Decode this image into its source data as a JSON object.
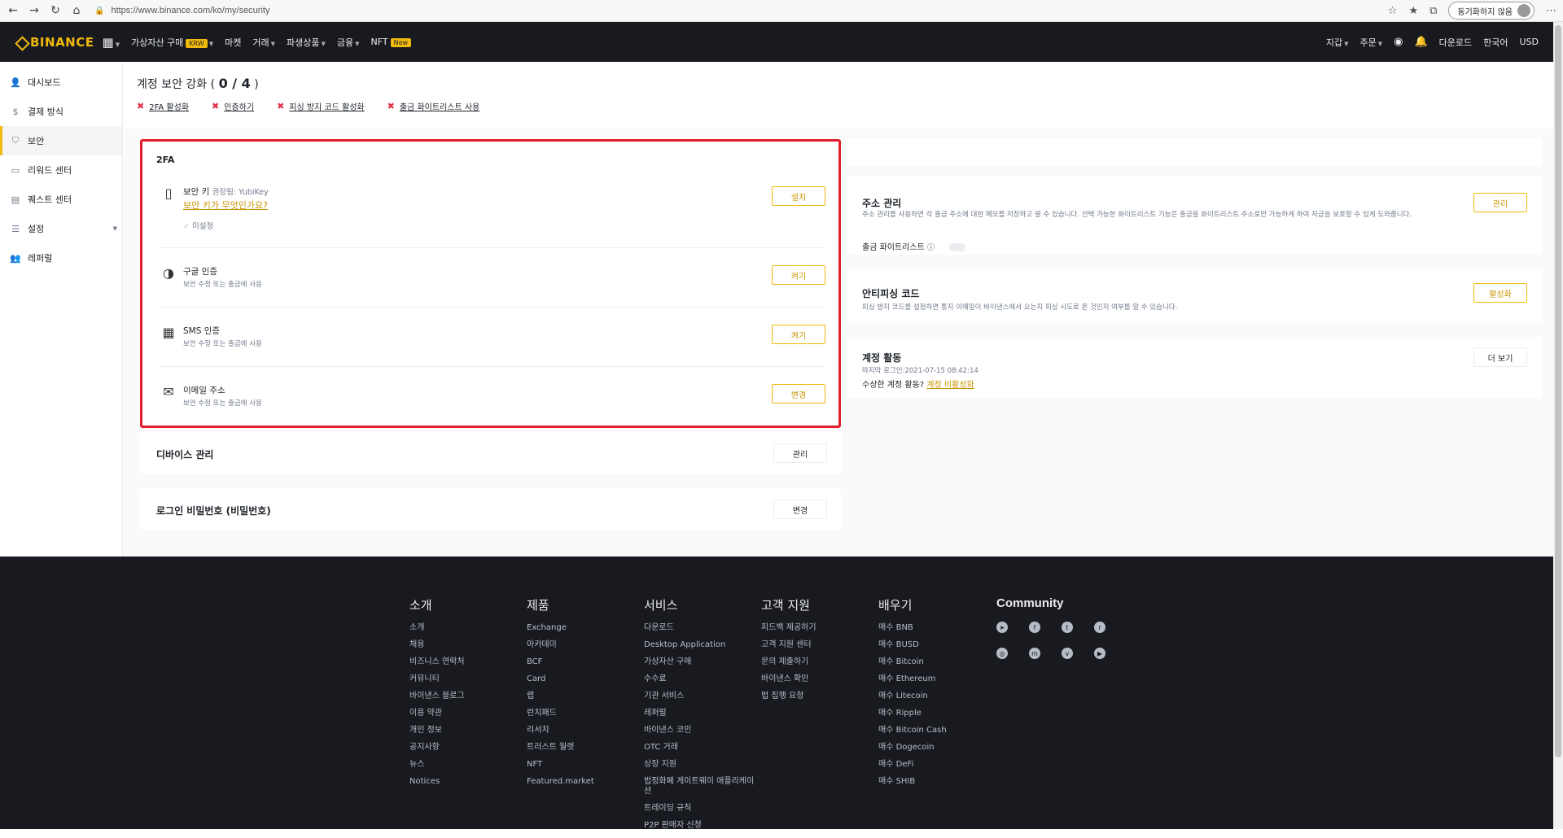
{
  "browser": {
    "url": "https://www.binance.com/ko/my/security",
    "sync_label": "동기화하지 않음"
  },
  "nav": {
    "logo": "BINANCE",
    "items": [
      "가상자산 구매",
      "마켓",
      "거래",
      "파생상품",
      "금융",
      "NFT"
    ],
    "krw_badge": "KRW",
    "new_badge": "New",
    "right": [
      "지갑",
      "주문",
      "다운로드",
      "한국어",
      "USD"
    ]
  },
  "sidebar": {
    "items": [
      {
        "label": "대시보드",
        "icon": "user-icon"
      },
      {
        "label": "결제 방식",
        "icon": "dollar-icon"
      },
      {
        "label": "보안",
        "icon": "shield-icon"
      },
      {
        "label": "리워드 센터",
        "icon": "ticket-icon"
      },
      {
        "label": "퀘스트 센터",
        "icon": "clipboard-icon"
      },
      {
        "label": "설정",
        "icon": "sliders-icon"
      },
      {
        "label": "레퍼럴",
        "icon": "user-plus-icon"
      }
    ]
  },
  "security": {
    "title": "계정 보안 강화",
    "progress": "0 / 4",
    "todos": [
      "2FA 활성화",
      "인증하기",
      "피싱 방지 코드 활성화",
      "출금 화이트리스트 사용"
    ]
  },
  "twofa": {
    "title": "2FA",
    "security_key": {
      "title": "보안 키",
      "recommended": "권장됨: YubiKey",
      "link": "보안 키가 무엇인가요?",
      "status": "미설정",
      "button": "설치"
    },
    "google": {
      "title": "구글 인증",
      "desc": "보안 수정 또는 출금에 사용",
      "button": "켜기"
    },
    "sms": {
      "title": "SMS 인증",
      "desc": "보안 수정 또는 출금에 사용",
      "button": "켜기"
    },
    "email": {
      "title": "이메일 주소",
      "desc": "보안 수정 또는 출금에 사용",
      "button": "변경"
    }
  },
  "device": {
    "title": "디바이스 관리",
    "button": "관리"
  },
  "password": {
    "title": "로그인 비밀번호 (비밀번호)",
    "button": "변경"
  },
  "address": {
    "title": "주소 관리",
    "desc": "주소 관리를 사용하면 각 출금 주소에 대한 메모를 저장하고 쓸 수 있습니다. 선택 가능한 화이트리스트 기능은 출금을 화이트리스트 주소로만 가능하게 하여 자금을 보호할 수 있게 도와줍니다.",
    "whitelist_label": "출금 화이트리스트",
    "button": "관리"
  },
  "antiphishing": {
    "title": "안티피싱 코드",
    "desc": "피싱 방지 코드를 설정하면 통지 이메일이 바이낸스에서 오는지 피싱 시도로 온 것인지 여부를 알 수 있습니다.",
    "button": "활성화"
  },
  "activity": {
    "title": "계정 활동",
    "last_login": "마지막 로그인:2021-07-15 08:42:14",
    "suspicious": "수상한 계정 활동?",
    "deactivate": "계정 비활성화",
    "button": "더 보기"
  },
  "footer": {
    "columns": [
      {
        "title": "소개",
        "links": [
          "소개",
          "채용",
          "비즈니스 연락처",
          "커뮤니티",
          "바이낸스 블로그",
          "이용 약관",
          "개인 정보",
          "공지사항",
          "뉴스",
          "Notices"
        ]
      },
      {
        "title": "제품",
        "links": [
          "Exchange",
          "아카데미",
          "BCF",
          "Card",
          "랩",
          "런치패드",
          "리서치",
          "트러스트 월렛",
          "NFT",
          "Featured.market"
        ]
      },
      {
        "title": "서비스",
        "links": [
          "다운로드",
          "Desktop Application",
          "가상자산 구매",
          "수수료",
          "기관 서비스",
          "레퍼럴",
          "바이낸스 코인",
          "OTC 거래",
          "상장 지원",
          "법정화폐 게이트웨이 애플리케이션",
          "트레이딩 규칙",
          "P2P 판매자 신청"
        ]
      },
      {
        "title": "고객 지원",
        "links": [
          "피드백 제공하기",
          "고객 지원 센터",
          "문의 제출하기",
          "바이낸스 확인",
          "법 집행 요청"
        ]
      },
      {
        "title": "배우기",
        "links": [
          "매수 BNB",
          "매수 BUSD",
          "매수 Bitcoin",
          "매수 Ethereum",
          "매수 Litecoin",
          "매수 Ripple",
          "매수 Bitcoin Cash",
          "매수 Dogecoin",
          "매수 DeFi",
          "매수 SHIB"
        ]
      }
    ],
    "community_title": "Community",
    "social": [
      "telegram-icon",
      "facebook-icon",
      "twitter-icon",
      "reddit-icon",
      "instagram-icon",
      "coinmarketcap-icon",
      "vk-icon",
      "youtube-icon"
    ]
  }
}
